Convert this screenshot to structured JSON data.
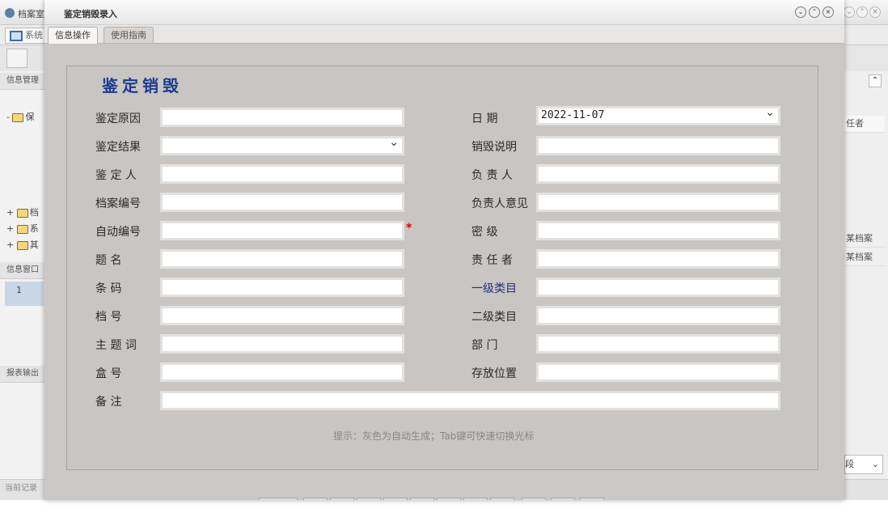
{
  "bg": {
    "title": "档案室",
    "tab_label": "系统",
    "section_1": "信息管理",
    "section_2": "信息窗口",
    "section_3": "报表输出",
    "status": "当前记录",
    "tree": [
      "保",
      "档",
      "系",
      "其"
    ],
    "row_num": "1",
    "right_header": "任者",
    "right_rows": [
      "某档案",
      "某档案"
    ],
    "right_select": "段"
  },
  "dialog": {
    "title": "鉴定销毁录入",
    "tabs": [
      "信息操作",
      "使用指南"
    ],
    "heading": "鉴定销毁",
    "hint": "提示：灰色为自动生成；Tab键可快速切换光标",
    "left_fields": [
      {
        "label": "鉴定原因",
        "value": ""
      },
      {
        "label": "鉴定结果",
        "value": ""
      },
      {
        "label": "鉴 定 人",
        "value": ""
      },
      {
        "label": "档案编号",
        "value": ""
      },
      {
        "label": "自动编号",
        "value": ""
      },
      {
        "label": "题 名",
        "value": ""
      },
      {
        "label": "条 码",
        "value": ""
      },
      {
        "label": "档 号",
        "value": ""
      },
      {
        "label": "主 题 词",
        "value": ""
      },
      {
        "label": "盒 号",
        "value": ""
      }
    ],
    "right_fields": [
      {
        "label": "日 期",
        "value": "2022-11-07"
      },
      {
        "label": "销毁说明",
        "value": ""
      },
      {
        "label": "负 责 人",
        "value": ""
      },
      {
        "label": "负责人意见",
        "value": ""
      },
      {
        "label": "密 级",
        "value": ""
      },
      {
        "label": "责 任 者",
        "value": ""
      },
      {
        "label": "一级类目",
        "value": ""
      },
      {
        "label": "二级类目",
        "value": ""
      },
      {
        "label": "部 门",
        "value": ""
      },
      {
        "label": "存放位置",
        "value": ""
      }
    ],
    "note": {
      "label": "备 注",
      "value": ""
    },
    "required_mark": "*",
    "accent_color": "#1a3b8f"
  }
}
